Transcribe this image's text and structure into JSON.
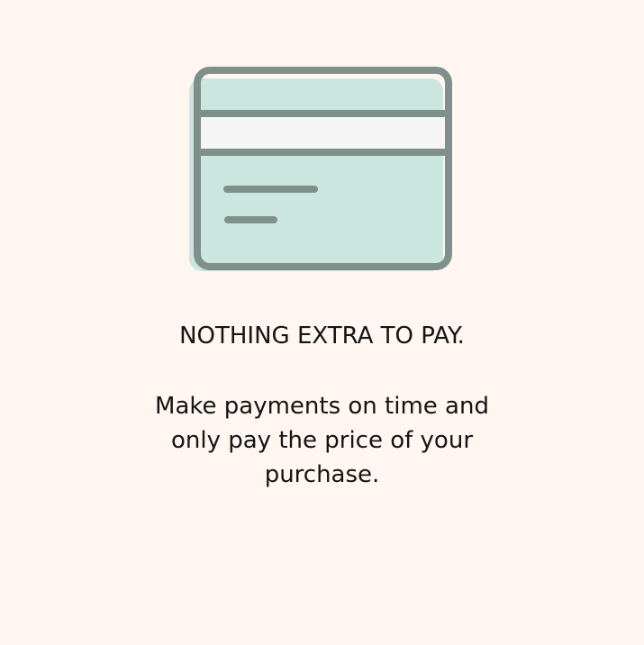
{
  "icon": {
    "name": "credit-card-icon",
    "fill_color": "#cbe6de",
    "stripe_color": "#f5f5f5",
    "stroke_color": "#7f8f8a"
  },
  "feature": {
    "headline": "NOTHING EXTRA TO PAY.",
    "description": "Make payments on time and only pay the price of your purchase."
  },
  "colors": {
    "background": "#fff6f2",
    "text": "#141414"
  }
}
